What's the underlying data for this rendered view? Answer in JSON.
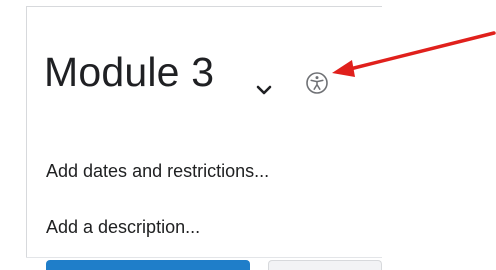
{
  "module": {
    "title": "Module 3",
    "toggle_icon": "chevron-down-icon",
    "accessibility_icon": "accessibility-icon"
  },
  "fields": {
    "dates_restrictions": "Add dates and restrictions...",
    "description": "Add a description..."
  },
  "colors": {
    "primary_button": "#1f7ec9",
    "annotation_arrow": "#e0201c"
  },
  "annotation": {
    "type": "red-arrow",
    "points_to": "accessibility-icon"
  }
}
